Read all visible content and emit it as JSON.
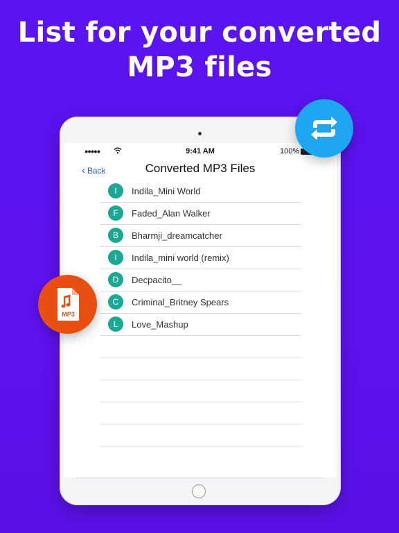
{
  "headline": {
    "line1": "List for your converted",
    "line2": "MP3 files"
  },
  "status_bar": {
    "signal": "●●●●●",
    "time": "9:41 AM",
    "battery": "100%"
  },
  "nav": {
    "back_label": "Back",
    "title": "Converted MP3 Files"
  },
  "files": [
    {
      "initial": "I",
      "name": "Indila_Mini World"
    },
    {
      "initial": "F",
      "name": "Faded_Alan Walker"
    },
    {
      "initial": "B",
      "name": "Bharmji_dreamcatcher"
    },
    {
      "initial": "I",
      "name": "Indila_mini world (remix)"
    },
    {
      "initial": "D",
      "name": "Decpacito__"
    },
    {
      "initial": "C",
      "name": "Criminal_Britney Spears"
    },
    {
      "initial": "L",
      "name": "Love_Mashup"
    }
  ],
  "icons": {
    "convert": "repeat-arrows-icon",
    "mp3_file": "mp3-file-icon",
    "mp3_file_label": "MP3"
  },
  "colors": {
    "background": "#5a14f0",
    "badge": "#19a994",
    "convert_button": "#1ea6f2",
    "mp3_button": "#ea4f12",
    "link": "#2b5fd9"
  }
}
